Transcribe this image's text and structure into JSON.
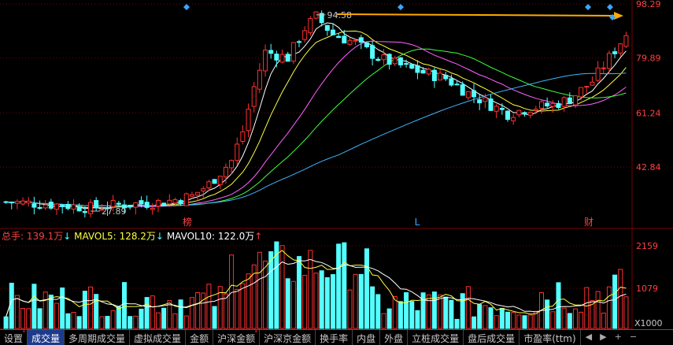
{
  "price_axis": {
    "ticks": [
      "98.29",
      "79.89",
      "61.24",
      "42.84"
    ],
    "tick_values": [
      98.29,
      79.89,
      61.24,
      42.84
    ],
    "high_label": "94.58",
    "low_label": "27.89"
  },
  "markers": {
    "m1": "榜",
    "m2": "L",
    "m3": "财"
  },
  "volume_axis": {
    "ticks": [
      "2159",
      "1079"
    ],
    "unit": "X1000"
  },
  "volume_header": {
    "total_label": "总手:",
    "total_value": "139.1万",
    "ma5_label": "MAVOL5:",
    "ma5_value": "128.2万",
    "ma10_label": "MAVOL10:",
    "ma10_value": "122.0万",
    "arrow_down": "↓",
    "arrow_up": "↑"
  },
  "tabs": [
    {
      "label": "设置",
      "dot": true
    },
    {
      "label": "成交量",
      "active": true
    },
    {
      "label": "多周期成交量"
    },
    {
      "label": "虚拟成交量"
    },
    {
      "label": "金额"
    },
    {
      "label": "沪深金额",
      "dot": true
    },
    {
      "label": "沪深京金额"
    },
    {
      "label": "换手率"
    },
    {
      "label": "内盘"
    },
    {
      "label": "外盘"
    },
    {
      "label": "立桩成交量"
    },
    {
      "label": "盘后成交量"
    },
    {
      "label": "市盈率(ttm)"
    }
  ],
  "tab_icons": [
    "◀",
    "▶",
    "+",
    "−"
  ],
  "colors": {
    "up": "#ff3030",
    "down": "#54ffff",
    "ma5": "#ffffff",
    "ma10": "#ffff40",
    "ma20": "#ff60ff",
    "ma30": "#40ff40",
    "ma60": "#3fb6ff",
    "grid": "#7a0000",
    "axis_text": "#ff4040",
    "arrow": "#ffaa00",
    "diamond": "#3aa6ff"
  }
}
